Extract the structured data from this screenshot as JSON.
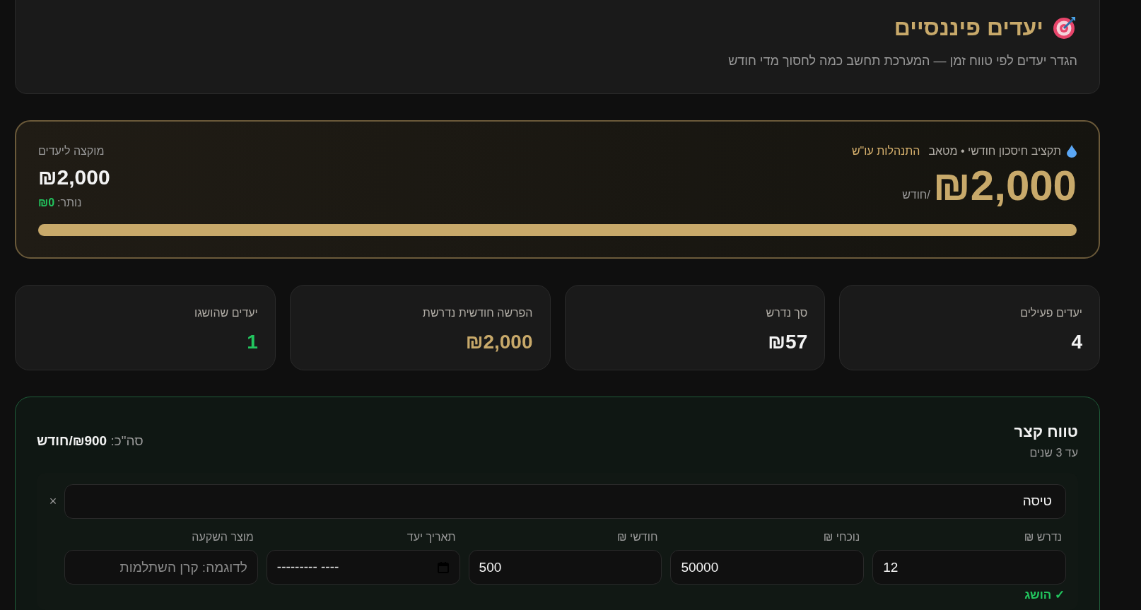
{
  "header": {
    "title": "יעדים פיננסיים",
    "subtitle": "הגדר יעדים לפי טווח זמן — המערכת תחשב כמה לחסוך מדי חודש"
  },
  "budget": {
    "label": "תקציב חיסכון חודשי • מטאב",
    "link": "התנהלות עו\"ש",
    "amount": "₪2,000",
    "unit": "/חודש",
    "allocated_label": "מוקצה ליעדים",
    "allocated": "₪2,000",
    "remaining_label": "נותר:",
    "remaining": "₪0",
    "level": 1
  },
  "stats": [
    {
      "label": "יעדים פעילים",
      "value": "4",
      "color": "#f3f3f3"
    },
    {
      "label": "סך נדרש",
      "value": "₪57",
      "color": "#f3f3f3"
    },
    {
      "label": "הפרשה חודשית נדרשת",
      "value": "₪2,000",
      "color": "#c8a96a"
    },
    {
      "label": "יעדים שהושגו",
      "value": "1",
      "color": "#22c55e"
    }
  ],
  "sections": [
    {
      "title": "טווח קצר",
      "subtitle": "עד 3 שנים",
      "total": "סה\"כ: **₪900/חודש**",
      "goals": [
        {
          "name": "טיסה",
          "remove": "×",
          "fields": [
            {
              "kind": "text",
              "label": "נדרש ₪",
              "value": "12"
            },
            {
              "kind": "text",
              "label": "נוכחי ₪",
              "value": "50000"
            },
            {
              "kind": "text",
              "label": "חודשי ₪",
              "value": "500"
            },
            {
              "kind": "date",
              "label": "תאריך יעד",
              "value": "--------- ----"
            },
            {
              "kind": "text",
              "label": "מוצר השקעה",
              "placeholder": "לדוגמה: קרן השתלמות"
            }
          ],
          "achieved": true,
          "status": "✓ הושג"
        }
      ]
    }
  ]
}
